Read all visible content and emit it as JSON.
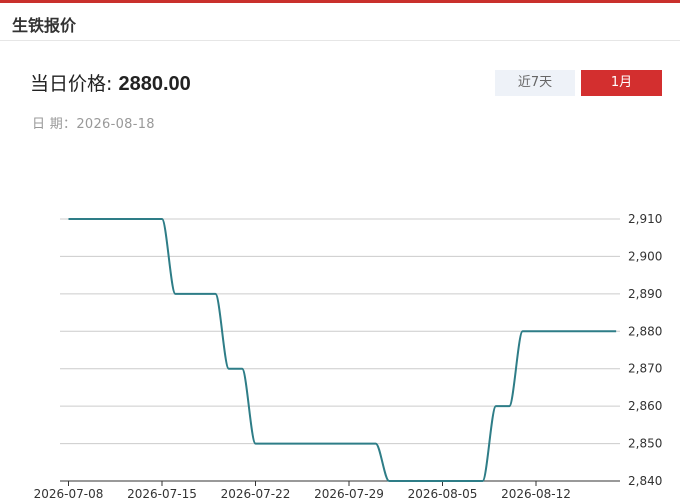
{
  "header": {
    "title": "生铁报价"
  },
  "price": {
    "label": "当日价格: ",
    "value": "2880.00"
  },
  "date": {
    "text": "日 期：2026-08-18"
  },
  "tabs": [
    {
      "label": "近7天",
      "active": false
    },
    {
      "label": "1月",
      "active": true
    }
  ],
  "colors": {
    "accent": "#d32f2f",
    "line": "#2e7d87",
    "grid": "#cccccc"
  },
  "chart_data": {
    "type": "line",
    "title": "",
    "xlabel": "",
    "ylabel": "",
    "ylim": [
      2840,
      2910
    ],
    "yticks": [
      2840,
      2850,
      2860,
      2870,
      2880,
      2890,
      2900,
      2910
    ],
    "ytick_labels": [
      "2,840",
      "2,850",
      "2,860",
      "2,870",
      "2,880",
      "2,890",
      "2,900",
      "2,910"
    ],
    "xticks": [
      "2026-07-08",
      "2026-07-15",
      "2026-07-22",
      "2026-07-29",
      "2026-08-05",
      "2026-08-12"
    ],
    "grid": true,
    "y_axis_side": "right",
    "x": [
      "2026-07-08",
      "2026-07-09",
      "2026-07-10",
      "2026-07-11",
      "2026-07-14",
      "2026-07-15",
      "2026-07-16",
      "2026-07-17",
      "2026-07-18",
      "2026-07-19",
      "2026-07-20",
      "2026-07-21",
      "2026-07-22",
      "2026-07-23",
      "2026-07-24",
      "2026-07-25",
      "2026-07-26",
      "2026-07-27",
      "2026-07-28",
      "2026-07-29",
      "2026-07-30",
      "2026-07-31",
      "2026-08-01",
      "2026-08-02",
      "2026-08-03",
      "2026-08-04",
      "2026-08-05",
      "2026-08-06",
      "2026-08-07",
      "2026-08-08",
      "2026-08-09",
      "2026-08-10",
      "2026-08-11",
      "2026-08-12",
      "2026-08-13",
      "2026-08-14",
      "2026-08-15",
      "2026-08-16",
      "2026-08-17",
      "2026-08-18"
    ],
    "values": [
      2910,
      2910,
      2910,
      2910,
      2910,
      2910,
      2890,
      2890,
      2890,
      2890,
      2870,
      2870,
      2850,
      2850,
      2850,
      2850,
      2850,
      2850,
      2850,
      2850,
      2850,
      2850,
      2840,
      2840,
      2840,
      2840,
      2840,
      2840,
      2840,
      2840,
      2860,
      2860,
      2880,
      2880,
      2880,
      2880,
      2880,
      2880,
      2880,
      2880
    ]
  }
}
